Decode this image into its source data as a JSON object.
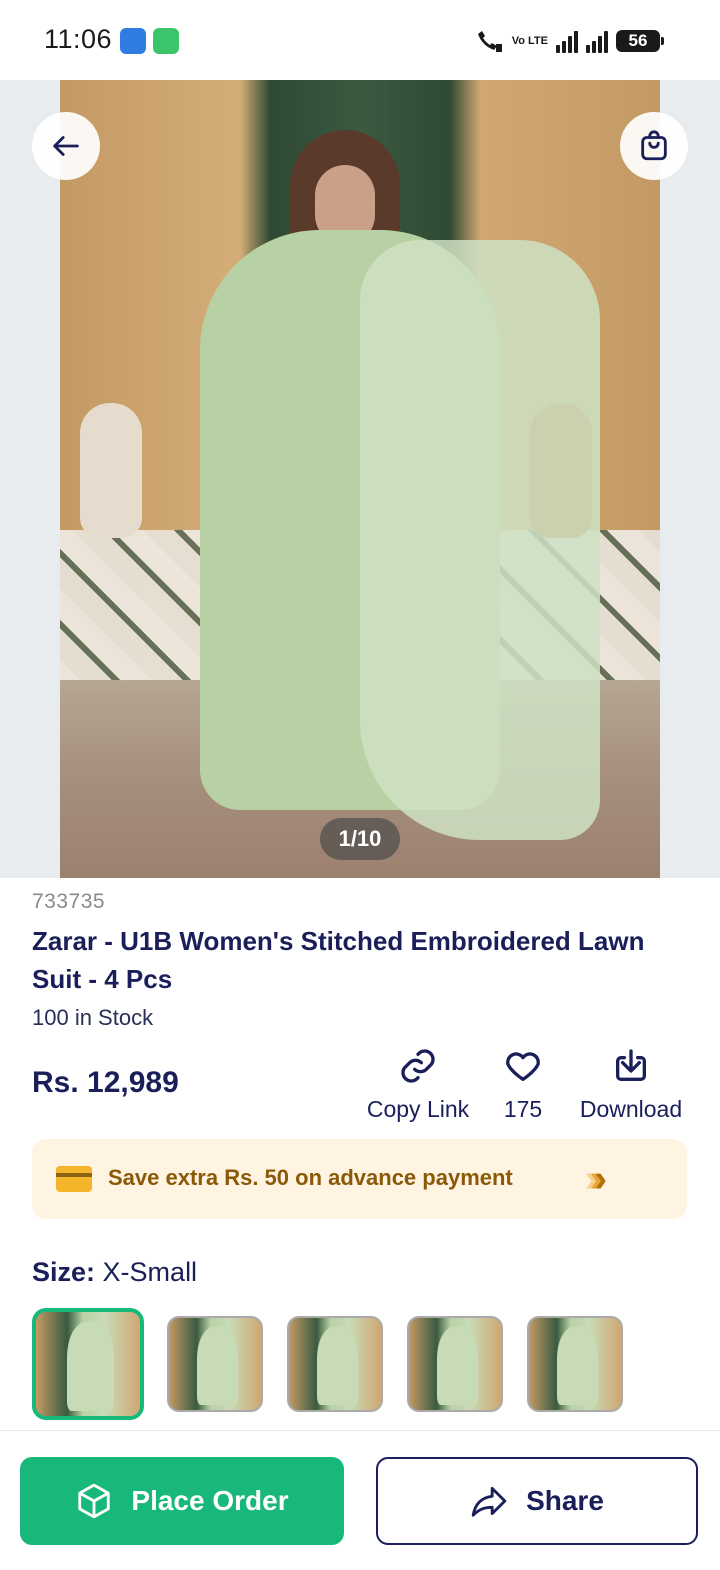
{
  "status_bar": {
    "time": "11:06",
    "volte_label": "Vo LTE",
    "battery": "56"
  },
  "gallery": {
    "counter": "1/10"
  },
  "product": {
    "sku": "733735",
    "title": "Zarar - U1B Women's Stitched Embroidered Lawn Suit - 4 Pcs",
    "stock": "100 in Stock",
    "price": "Rs. 12,989"
  },
  "actions": {
    "copy_link": "Copy Link",
    "likes": "175",
    "download": "Download"
  },
  "promo": {
    "text": "Save extra Rs. 50 on advance payment",
    "colors": {
      "background": "#fff3e1",
      "text": "#8a5a08"
    }
  },
  "size": {
    "label": "Size:",
    "selected": "X-Small",
    "swatch_count": 5
  },
  "bottom_bar": {
    "place_order": "Place Order",
    "share": "Share",
    "colors": {
      "primary": "#17b87a",
      "navy": "#1a1f5a"
    }
  },
  "icons": [
    "back-arrow-icon",
    "shopping-bag-icon",
    "link-icon",
    "heart-icon",
    "download-icon",
    "credit-card-icon",
    "chevrons-right-icon",
    "box-icon",
    "share-icon"
  ]
}
